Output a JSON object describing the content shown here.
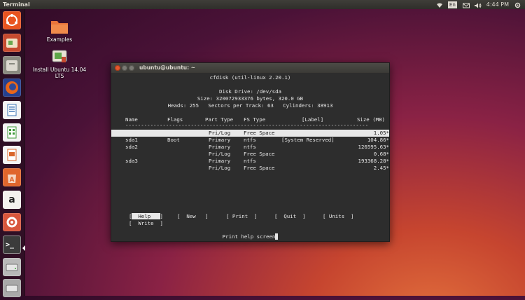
{
  "topbar": {
    "app_title": "Terminal",
    "keyboard_layout": "En",
    "time": "4:44 PM",
    "icons": [
      "wifi-icon",
      "keyboard-layout-indicator",
      "mail-icon",
      "volume-icon",
      "session-gear-icon"
    ]
  },
  "launcher": {
    "items": [
      {
        "name": "ubuntu-dash-icon",
        "color": "#e95420"
      },
      {
        "name": "ubuntu-installer-icon",
        "color": "#c64a2f"
      },
      {
        "name": "files-icon",
        "color": "#8a8a80"
      },
      {
        "name": "firefox-icon",
        "color": "#e8661a"
      },
      {
        "name": "libreoffice-writer-icon",
        "color": "#3d74b6"
      },
      {
        "name": "libreoffice-calc-icon",
        "color": "#3f9a3a"
      },
      {
        "name": "libreoffice-impress-icon",
        "color": "#d9662b"
      },
      {
        "name": "ubuntu-software-center-icon",
        "color": "#e0662c"
      },
      {
        "name": "amazon-icon",
        "color": "#f4f2ee"
      },
      {
        "name": "system-settings-icon",
        "color": "#d8563c"
      },
      {
        "name": "terminal-icon",
        "color": "#3b3b3b"
      },
      {
        "name": "drive-icon",
        "color": "#b9b9b9"
      },
      {
        "name": "drive-icon-2",
        "color": "#a9a9a9"
      }
    ],
    "glyphs": {
      "amazon": "a",
      "terminal": ">_"
    }
  },
  "desktop": {
    "examples_label": "Examples",
    "install_label_line1": "Install Ubuntu 14.04",
    "install_label_line2": "LTS"
  },
  "window": {
    "title": "ubuntu@ubuntu: ~"
  },
  "cfdisk": {
    "header": "cfdisk (util-linux 2.20.1)",
    "disk_drive": "Disk Drive: /dev/sda",
    "size_line": "Size: 320072933376 bytes, 320.0 GB",
    "geometry_line": "Heads: 255   Sectors per Track: 63   Cylinders: 38913",
    "columns": {
      "name": "Name",
      "flags": "Flags",
      "part_type": "Part Type",
      "fs_type": "FS Type",
      "label": "[Label]",
      "size": "Size (MB)"
    },
    "rule": "------------------------------------------------------------------------------",
    "rows": [
      {
        "name": "",
        "flags": "",
        "part_type": "Pri/Log",
        "fs_type": "Free Space",
        "label": "",
        "size": "1.05*"
      },
      {
        "name": "sda1",
        "flags": "Boot",
        "part_type": "Primary",
        "fs_type": "ntfs",
        "label": "[System Reserved]",
        "size": "104.86*"
      },
      {
        "name": "sda2",
        "flags": "",
        "part_type": "Primary",
        "fs_type": "ntfs",
        "label": "",
        "size": "126595.63*"
      },
      {
        "name": "",
        "flags": "",
        "part_type": "Pri/Log",
        "fs_type": "Free Space",
        "label": "",
        "size": "0.68*"
      },
      {
        "name": "sda3",
        "flags": "",
        "part_type": "Primary",
        "fs_type": "ntfs",
        "label": "",
        "size": "193368.28*"
      },
      {
        "name": "",
        "flags": "",
        "part_type": "Pri/Log",
        "fs_type": "Free Space",
        "label": "",
        "size": "2.45*"
      }
    ],
    "menu": {
      "help": "Help",
      "new": "New",
      "print": "Print",
      "quit": "Quit",
      "units": "Units",
      "write": "Write"
    },
    "status": "Print help screen"
  }
}
